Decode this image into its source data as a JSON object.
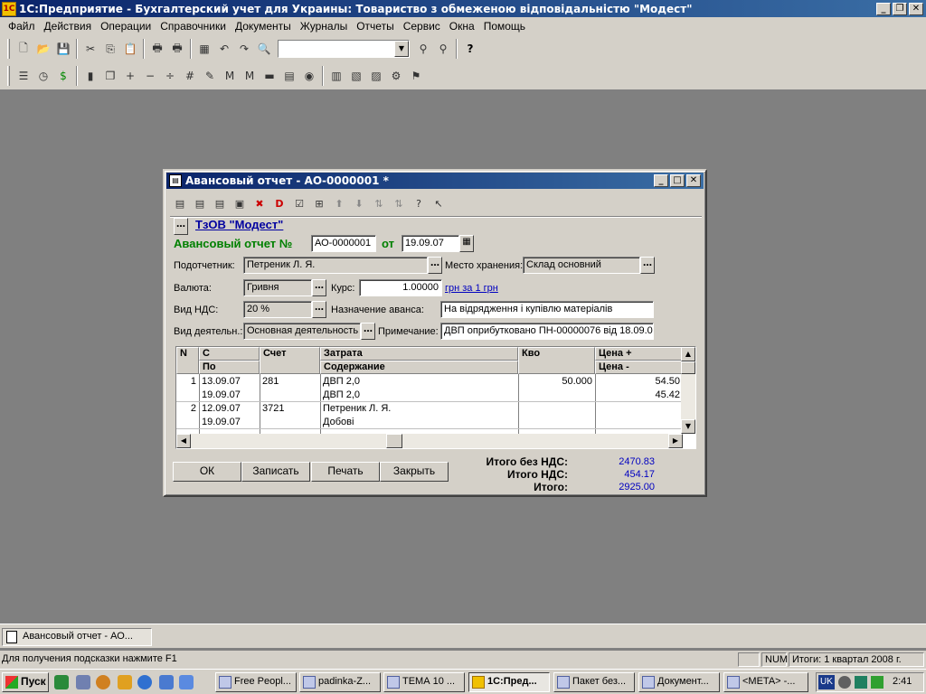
{
  "app": {
    "title": "1С:Предприятие - Бухгалтерский учет для Украины: Товариство з обмеженою відповідальністю \"Модест\"",
    "menu": [
      "Файл",
      "Действия",
      "Операции",
      "Справочники",
      "Документы",
      "Журналы",
      "Отчеты",
      "Сервис",
      "Окна",
      "Помощь"
    ]
  },
  "dialog": {
    "title": "Авансовый отчет - АО-0000001 *",
    "org_link": "ТзОВ \"Модест\"",
    "doc_label": "Авансовый отчет №",
    "doc_number": "АО-0000001",
    "date_label": "от",
    "date": "19.09.07",
    "fields": {
      "accountable_label": "Подотчетник:",
      "accountable": "Петреник Л. Я.",
      "storage_label": "Место хранения:",
      "storage": "Склад  основний",
      "currency_label": "Валюта:",
      "currency": "Гривня",
      "rate_label": "Курс:",
      "rate": "1.00000",
      "rate_link": "грн за 1 грн",
      "vat_label": "Вид НДС:",
      "vat": "20 %",
      "purpose_label": "Назначение аванса:",
      "purpose": "На відрядження і купівлю матеріалів",
      "activity_label": "Вид деятельн.:",
      "activity": "Основная деятельность",
      "note_label": "Примечание:",
      "note": "ДВП оприбутковано ПН-00000076 від 18.09.0"
    },
    "grid": {
      "headers": {
        "n": "N",
        "from": "С",
        "to": "По",
        "account": "Счет",
        "cost": "Затрата",
        "content": "Содержание",
        "qty": "Кво",
        "price_plus": "Цена +",
        "price_minus": "Цена -"
      },
      "rows": [
        {
          "n": "1",
          "from": "13.09.07",
          "to": "19.09.07",
          "account": "281",
          "cost": "ДВП 2,0",
          "content": "ДВП 2,0",
          "qty": "50.000",
          "price_plus": "54.50",
          "price_minus": "45.42"
        },
        {
          "n": "2",
          "from": "12.09.07",
          "to": "19.09.07",
          "account": "3721",
          "cost": "Петреник Л. Я.",
          "content": "Добові",
          "qty": "",
          "price_plus": "",
          "price_minus": ""
        }
      ]
    },
    "buttons": {
      "ok": "ОК",
      "save": "Записать",
      "print": "Печать",
      "close": "Закрыть"
    },
    "totals": {
      "no_vat_label": "Итого без НДС:",
      "no_vat": "2470.83",
      "vat_label": "Итого НДС:",
      "vat": "454.17",
      "total_label": "Итого:",
      "total": "2925.00"
    }
  },
  "doctab": "Авансовый отчет - АО...",
  "status": {
    "hint": "Для получения подсказки нажмите F1",
    "num": "NUM",
    "period": "Итоги: 1 квартал 2008 г."
  },
  "taskbar": {
    "start": "Пуск",
    "tasks": [
      "Free Peopl...",
      "padinka-Z...",
      "ТЕМА 10 ...",
      "1С:Пред...",
      "Пакет без...",
      "Документ...",
      "<META> -..."
    ],
    "lang": "UK",
    "clock": "2:41"
  }
}
